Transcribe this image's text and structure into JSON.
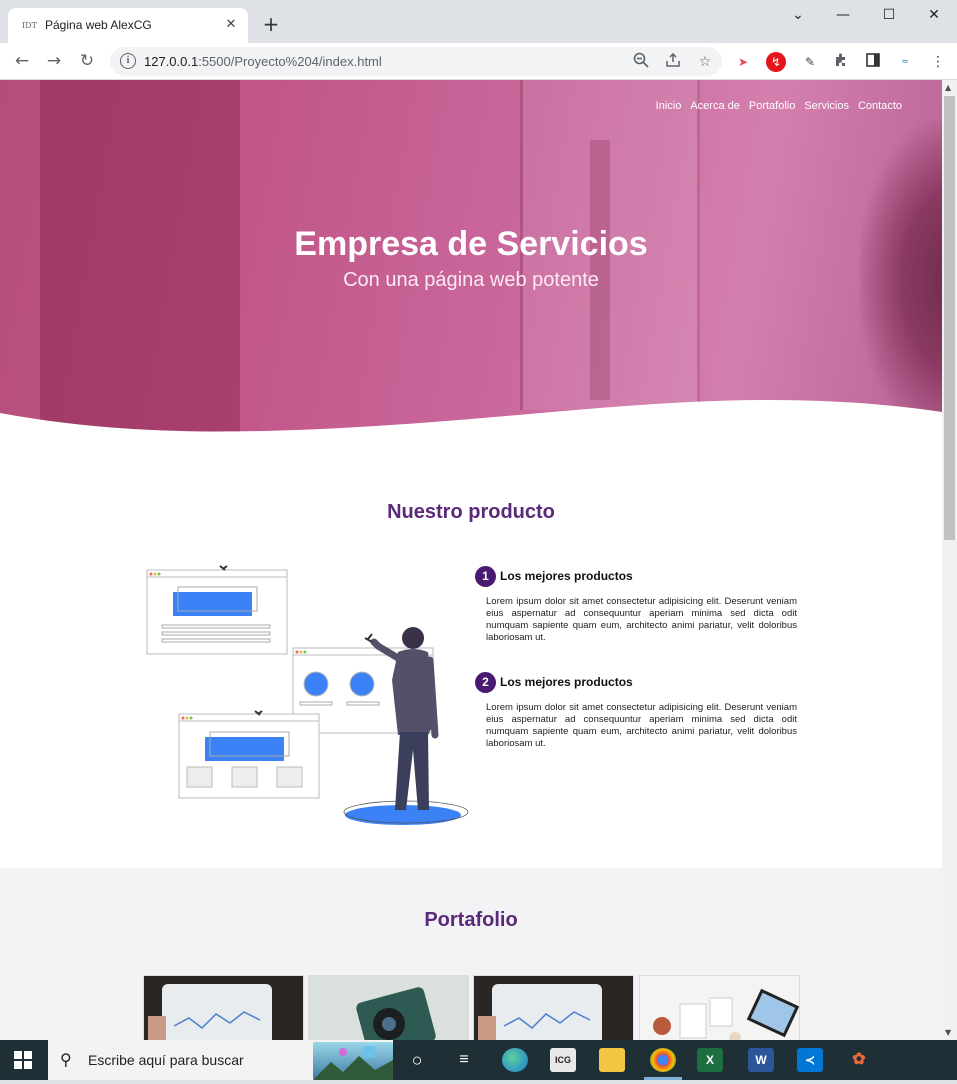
{
  "browser": {
    "tab_title": "Página web AlexCG",
    "favicon_text": "IDT",
    "tab_close": "✕",
    "new_tab": "+",
    "url_host": "127.0.0.1",
    "url_path": ":5500/Proyecto%204/index.html",
    "window_controls": [
      "⌄",
      "—",
      "☐",
      "✕"
    ]
  },
  "page": {
    "nav": [
      "Inicio",
      "Acerca de",
      "Portafolio",
      "Servicios",
      "Contacto"
    ],
    "hero_title": "Empresa de Servicios",
    "hero_subtitle": "Con una página web potente",
    "product_title": "Nuestro producto",
    "features": [
      {
        "number": "1",
        "title": "Los mejores productos",
        "text": "Lorem ipsum dolor sit amet consectetur adipisicing elit. Deserunt veniam eius aspernatur ad consequuntur aperiam minima sed dicta odit numquam sapiente quam eum, architecto animi pariatur, velit doloribus laboriosam ut."
      },
      {
        "number": "2",
        "title": "Los mejores productos",
        "text": "Lorem ipsum dolor sit amet consectetur adipisicing elit. Deserunt veniam eius aspernatur ad consequuntur aperiam minima sed dicta odit numquam sapiente quam eum, architecto animi pariatur, velit doloribus laboriosam ut."
      }
    ],
    "portfolio_title": "Portafolio"
  },
  "taskbar": {
    "search_placeholder": "Escribe aquí para buscar",
    "apps": [
      "task-view",
      "edge",
      "icg",
      "file-explorer",
      "chrome",
      "excel",
      "word",
      "vscode",
      "paint"
    ]
  },
  "colors": {
    "accent": "#5a2a7a",
    "badge": "#4a1a72",
    "hero": "#c2588a",
    "illustration_blue": "#3b82f6"
  }
}
